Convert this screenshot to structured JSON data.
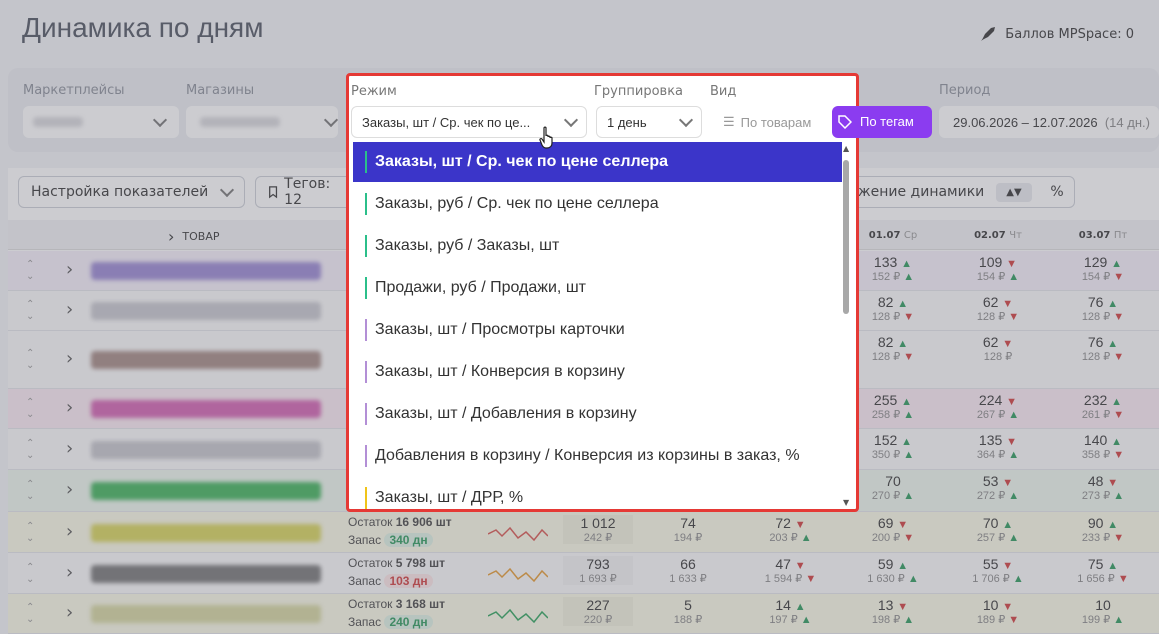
{
  "page_title": "Динамика по дням",
  "points_label": "Баллов MPSpace: 0",
  "filters": {
    "marketplaces_label": "Маркетплейсы",
    "shops_label": "Магазины",
    "period_label": "Период",
    "period_value": "29.06.2026 – 12.07.2026",
    "period_days": "(14 дн.)"
  },
  "toolbar": {
    "settings_label": "Настройка показателей",
    "tags_label": "Тегов: 12",
    "dynamics_label": "жение динамики",
    "sort_icon": "sort-arrows-icon",
    "percent_label": "%"
  },
  "table": {
    "product_header": "ТОВАР",
    "dates": [
      {
        "date": "01.07",
        "day": "Ср"
      },
      {
        "date": "02.07",
        "day": "Чт"
      },
      {
        "date": "03.07",
        "day": "Пт"
      }
    ],
    "rows": [
      {
        "c1": {
          "v": "133",
          "t": "up",
          "s": "152 ₽",
          "st": "up"
        },
        "c2": {
          "v": "109",
          "t": "dn",
          "s": "154 ₽",
          "st": "up"
        },
        "c3": {
          "v": "129",
          "t": "up",
          "s": "154 ₽",
          "st": "dn"
        }
      },
      {
        "c1": {
          "v": "82",
          "t": "up",
          "s": "128 ₽",
          "st": "dn"
        },
        "c2": {
          "v": "62",
          "t": "dn",
          "s": "128 ₽",
          "st": "dn"
        },
        "c3": {
          "v": "76",
          "t": "up",
          "s": "128 ₽",
          "st": "dn"
        }
      },
      {
        "c1": {
          "v": "82",
          "t": "up",
          "s": "128 ₽",
          "st": "dn"
        },
        "c2": {
          "v": "62",
          "t": "dn",
          "s": "128 ₽",
          "st": ""
        },
        "c3": {
          "v": "76",
          "t": "up",
          "s": "128 ₽",
          "st": "dn"
        }
      },
      {
        "c1": {
          "v": "255",
          "t": "up",
          "s": "258 ₽",
          "st": "up"
        },
        "c2": {
          "v": "224",
          "t": "dn",
          "s": "267 ₽",
          "st": "up"
        },
        "c3": {
          "v": "232",
          "t": "up",
          "s": "261 ₽",
          "st": "dn"
        }
      },
      {
        "c1": {
          "v": "152",
          "t": "up",
          "s": "350 ₽",
          "st": "up"
        },
        "c2": {
          "v": "135",
          "t": "dn",
          "s": "364 ₽",
          "st": "up"
        },
        "c3": {
          "v": "140",
          "t": "up",
          "s": "358 ₽",
          "st": "dn"
        }
      },
      {
        "c1": {
          "v": "70",
          "t": "",
          "s": "270 ₽",
          "st": "up"
        },
        "c2": {
          "v": "53",
          "t": "dn",
          "s": "272 ₽",
          "st": "up"
        },
        "c3": {
          "v": "48",
          "t": "dn",
          "s": "273 ₽",
          "st": "up"
        }
      },
      {
        "stock": "16 906 шт",
        "reserve": "340 дн",
        "sum": "1 012",
        "sum_sub": "242 ₽",
        "d0": "74",
        "d0s": "194 ₽",
        "d1": "72",
        "d1t": "dn",
        "d1s": "203 ₽",
        "d1st": "up",
        "c1": {
          "v": "69",
          "t": "dn",
          "s": "200 ₽",
          "st": "dn"
        },
        "c2": {
          "v": "70",
          "t": "up",
          "s": "257 ₽",
          "st": "up"
        },
        "c3": {
          "v": "90",
          "t": "up",
          "s": "233 ₽",
          "st": "dn"
        }
      },
      {
        "stock": "5 798 шт",
        "reserve": "103 дн",
        "sum": "793",
        "sum_sub": "1 693 ₽",
        "d0": "66",
        "d0s": "1 633 ₽",
        "d1": "47",
        "d1t": "dn",
        "d1s": "1 594 ₽",
        "d1st": "dn",
        "c1": {
          "v": "59",
          "t": "up",
          "s": "1 630 ₽",
          "st": "up"
        },
        "c2": {
          "v": "55",
          "t": "dn",
          "s": "1 706 ₽",
          "st": "up"
        },
        "c3": {
          "v": "75",
          "t": "up",
          "s": "1 656 ₽",
          "st": "dn"
        }
      },
      {
        "stock": "3 168 шт",
        "reserve": "240 дн",
        "sum": "227",
        "sum_sub": "220 ₽",
        "d0": "5",
        "d0s": "188 ₽",
        "d1": "14",
        "d1t": "up",
        "d1s": "197 ₽",
        "d1st": "up",
        "c1": {
          "v": "13",
          "t": "dn",
          "s": "198 ₽",
          "st": "up"
        },
        "c2": {
          "v": "10",
          "t": "dn",
          "s": "189 ₽",
          "st": "dn"
        },
        "c3": {
          "v": "10",
          "t": "",
          "s": "199 ₽",
          "st": "up"
        }
      }
    ],
    "stock_label": "Остаток",
    "reserve_label": "Запас"
  },
  "dropdown": {
    "mode_label": "Режим",
    "mode_value": "Заказы, шт / Ср. чек по це...",
    "group_label": "Группировка",
    "group_value": "1 день",
    "view_label": "Вид",
    "view_products": "По товарам",
    "view_tags": "По тегам",
    "options": [
      {
        "label": "Заказы, шт / Ср. чек по цене селлера",
        "color": "#2bbf8a",
        "active": true
      },
      {
        "label": "Заказы, руб / Ср. чек по цене селлера",
        "color": "#2bbf8a",
        "active": false
      },
      {
        "label": "Заказы, руб / Заказы, шт",
        "color": "#2bbf8a",
        "active": false
      },
      {
        "label": "Продажи, руб / Продажи, шт",
        "color": "#2bbf8a",
        "active": false
      },
      {
        "label": "Заказы, шт / Просмотры карточки",
        "color": "#b38fd6",
        "active": false
      },
      {
        "label": "Заказы, шт / Конверсия в корзину",
        "color": "#b38fd6",
        "active": false
      },
      {
        "label": "Заказы, шт / Добавления в корзину",
        "color": "#b38fd6",
        "active": false
      },
      {
        "label": "Добавления в корзину / Конверсия из корзины в заказ, %",
        "color": "#b38fd6",
        "active": false
      },
      {
        "label": "Заказы, шт / ДРР, %",
        "color": "#f0c419",
        "active": false
      }
    ]
  }
}
